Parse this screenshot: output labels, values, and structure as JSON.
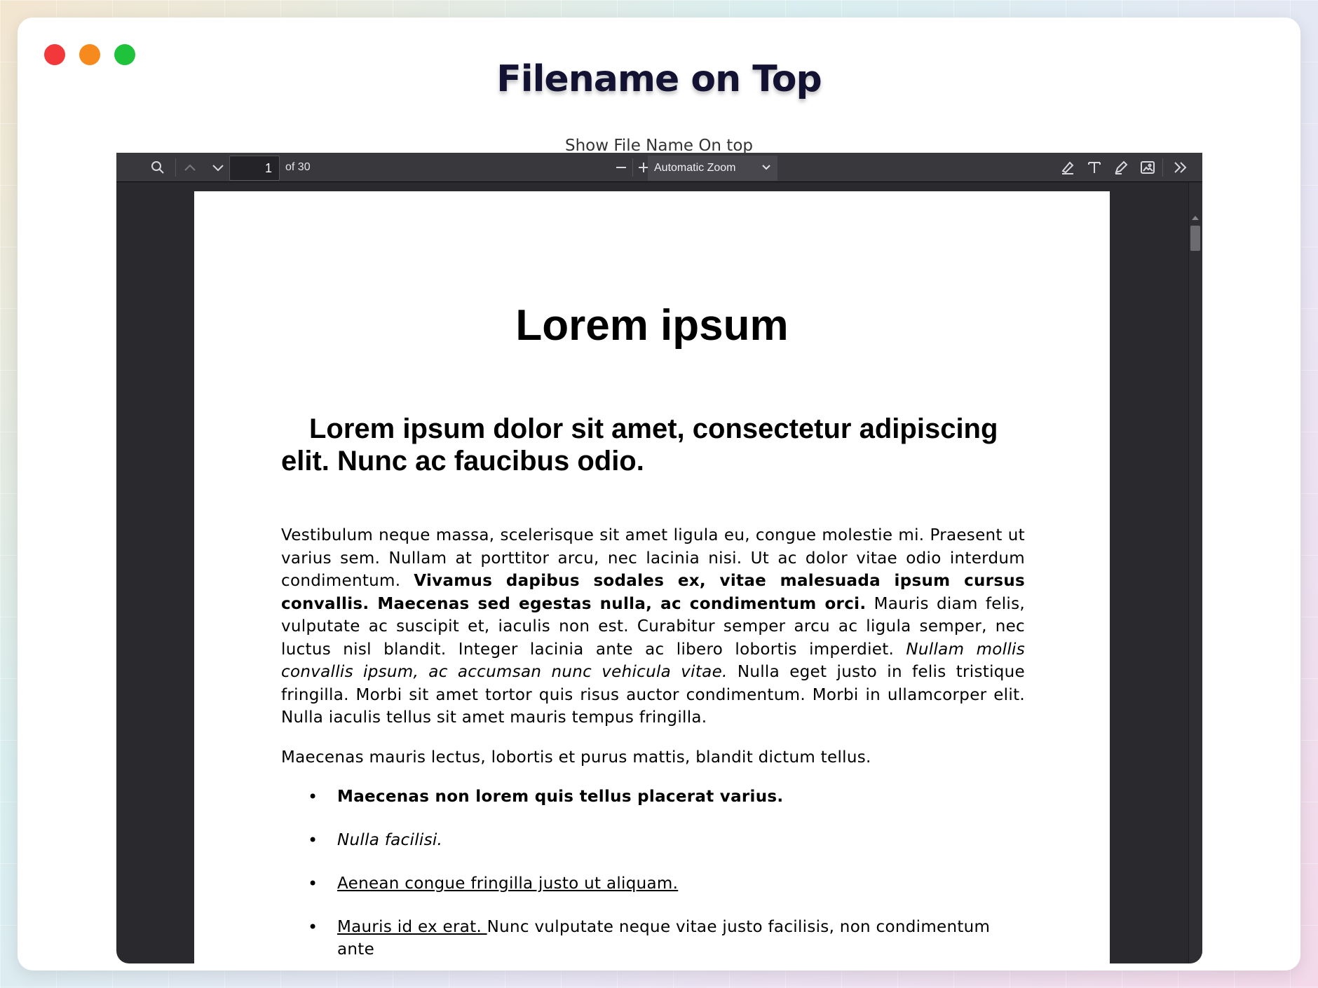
{
  "window": {
    "title": "Filename on Top",
    "subtitle": "Show File Name On top"
  },
  "toolbar": {
    "page_number": "1",
    "page_of": "of 30",
    "zoom_value": "Automatic Zoom",
    "icons": [
      "search-icon",
      "chevron-up-icon",
      "chevron-down-icon",
      "minus-icon",
      "plus-icon",
      "highlight-icon",
      "text-icon",
      "draw-icon",
      "image-icon",
      "double-chevron-right-icon"
    ]
  },
  "document": {
    "title": "Lorem ipsum",
    "heading": "Lorem ipsum dolor sit amet, consectetur adipiscing elit. Nunc ac faucibus odio.",
    "para1": {
      "s1": "Vestibulum neque massa, scelerisque sit amet ligula eu, congue molestie mi. Praesent ut varius sem. Nullam at porttitor arcu, nec lacinia nisi. Ut ac dolor vitae odio interdum condimentum. ",
      "s2_bold": "Vivamus dapibus sodales ex, vitae malesuada ipsum cursus convallis. Maecenas sed egestas nulla, ac condimentum orci.",
      "s3": " Mauris diam felis, vulputate ac suscipit et, iaculis non est. Curabitur semper arcu ac ligula semper, nec luctus nisl blandit. Integer lacinia ante ac libero lobortis imperdiet. ",
      "s4_italic": "Nullam mollis convallis ipsum, ac accumsan nunc vehicula vitae.",
      "s5": " Nulla eget justo in felis tristique fringilla. Morbi sit amet tortor quis risus auctor condimentum. Morbi in ullamcorper elit. Nulla iaculis tellus sit amet mauris tempus fringilla."
    },
    "para2": "Maecenas mauris lectus, lobortis et purus mattis, blandit dictum tellus.",
    "bullets": {
      "b1": "Maecenas non lorem quis tellus placerat varius.",
      "b2": "Nulla facilisi.",
      "b3": "Aenean congue fringilla justo ut aliquam. ",
      "b4_link": "Mauris id ex erat. ",
      "b4_rest": "Nunc vulputate neque vitae justo facilisis, non condimentum ante",
      "glyph": "•"
    }
  },
  "colors": {
    "close": "#f2383a",
    "minimize": "#f78a1d",
    "maximize": "#1ec23b",
    "viewer_bg": "#2a2a2e",
    "toolbar_bg": "#38383d"
  }
}
